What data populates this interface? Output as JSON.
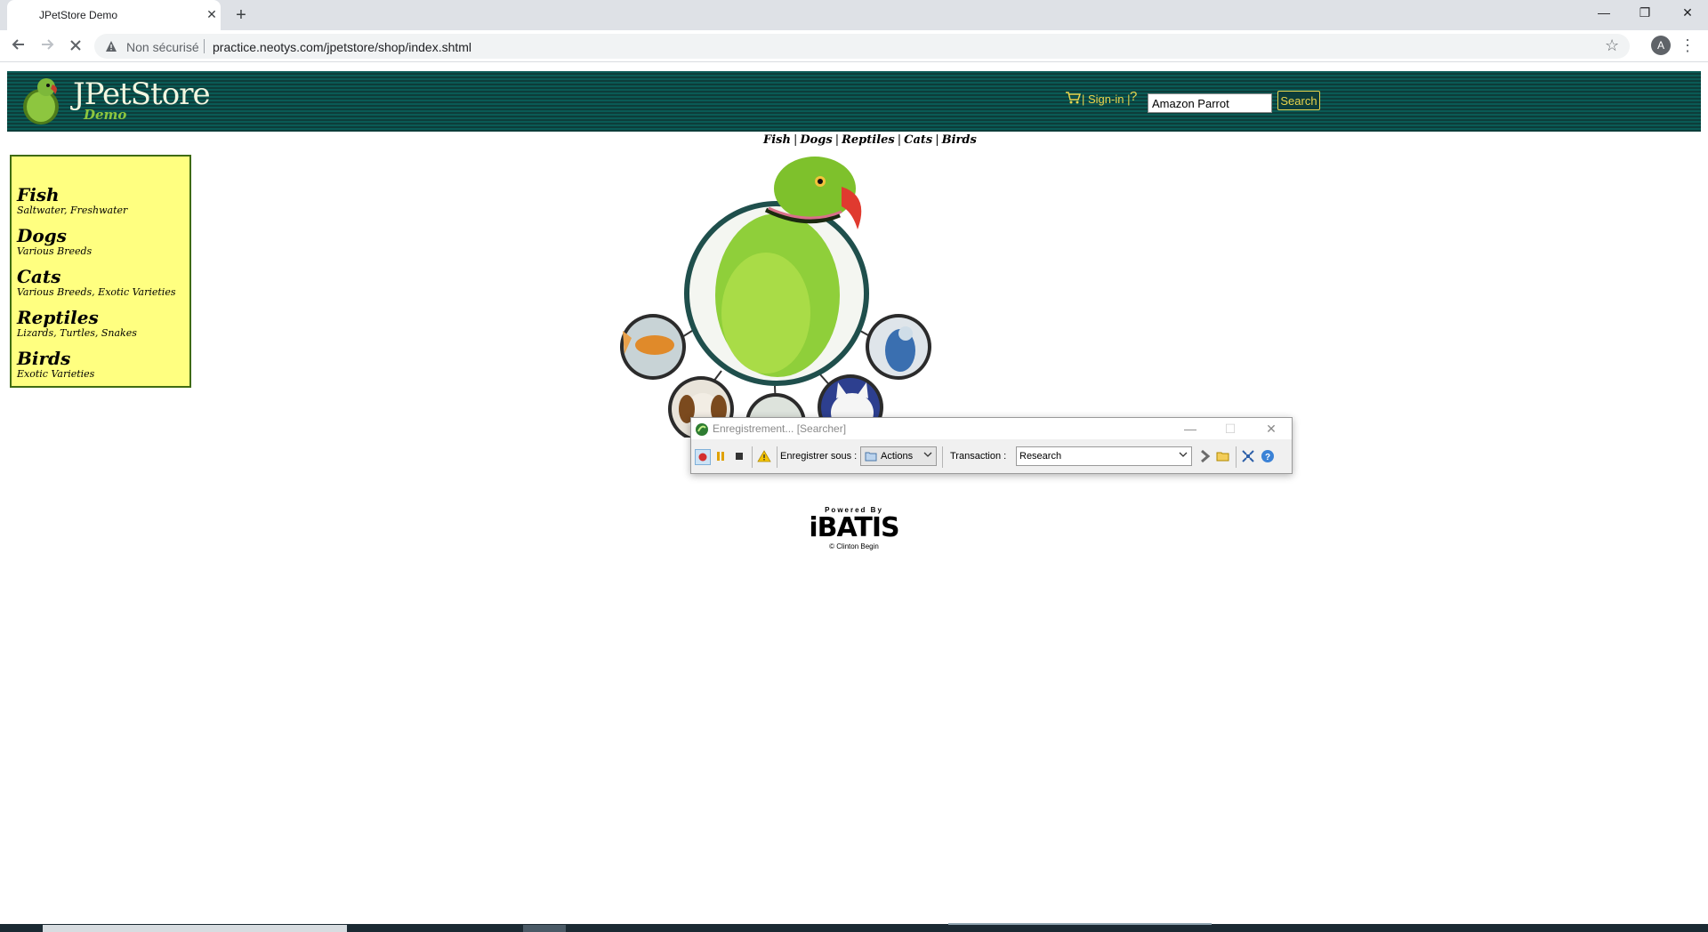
{
  "browser": {
    "tab_title": "JPetStore Demo",
    "tab_close": "✕",
    "new_tab": "+",
    "window_controls": {
      "minimize": "—",
      "restore": "❐",
      "close": "✕"
    },
    "security_label": "Non sécurisé",
    "url": "practice.neotys.com/jpetstore/shop/index.shtml",
    "profile_initial": "A",
    "menu_glyph": "⋮",
    "star_glyph": "☆"
  },
  "header": {
    "logo_text": "JPetStore",
    "logo_subtitle": "Demo",
    "signin_label": "| Sign-in |",
    "help_glyph": "?",
    "search_value": "Amazon Parrot",
    "search_button": "Search",
    "colors": {
      "band": "#0d3d3a",
      "accent": "#e8d44d"
    }
  },
  "quick_links": [
    "Fish",
    "Dogs",
    "Reptiles",
    "Cats",
    "Birds"
  ],
  "quick_links_separator": "|",
  "sidebar": {
    "categories": [
      {
        "name": "Fish",
        "description": "Saltwater, Freshwater"
      },
      {
        "name": "Dogs",
        "description": "Various Breeds"
      },
      {
        "name": "Cats",
        "description": "Various Breeds, Exotic Varieties"
      },
      {
        "name": "Reptiles",
        "description": "Lizards, Turtles, Snakes"
      },
      {
        "name": "Birds",
        "description": "Exotic Varieties"
      }
    ],
    "background": "#ffff80"
  },
  "recorder": {
    "title": "Enregistrement... [Searcher]",
    "save_under_label": "Enregistrer sous :",
    "save_under_value": "Actions",
    "transaction_label": "Transaction :",
    "transaction_value": "Research",
    "window_controls": {
      "minimize": "—",
      "maximize": "☐",
      "close": "✕"
    }
  },
  "footer": {
    "powered_by": "Powered By",
    "brand": "iBATIS",
    "copyright": "© Clinton Begin"
  }
}
